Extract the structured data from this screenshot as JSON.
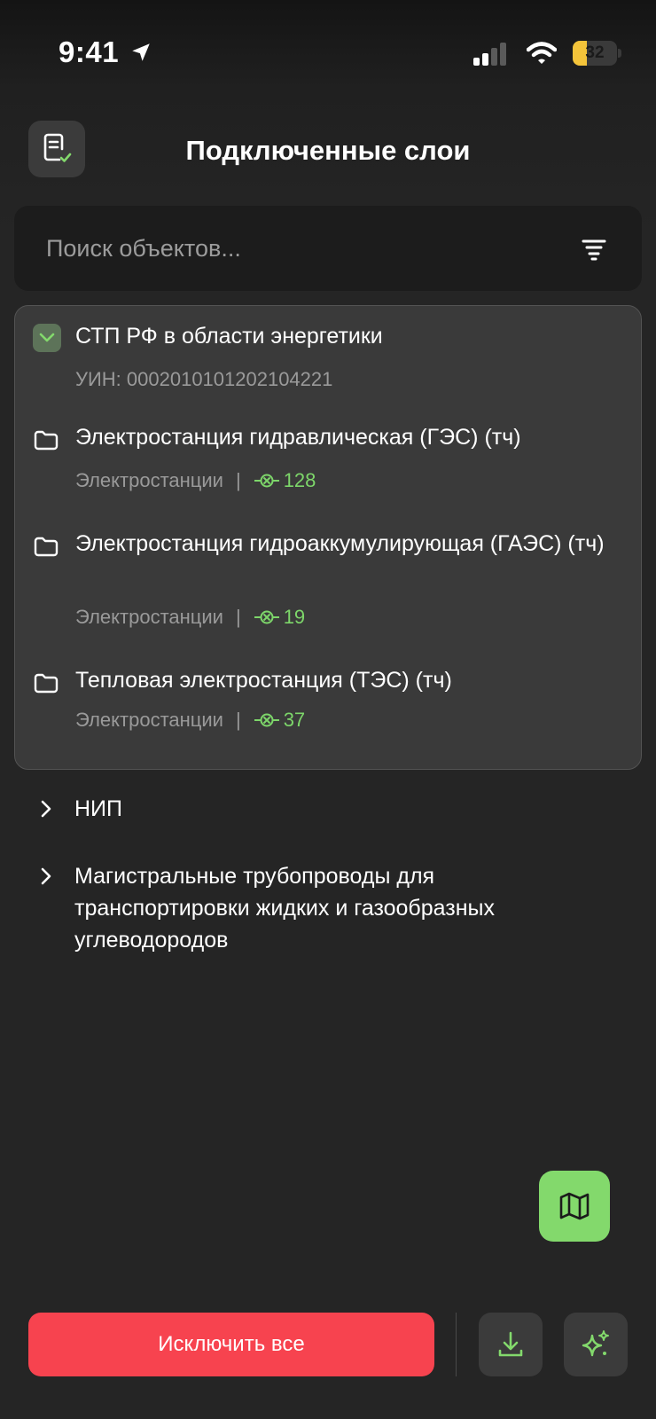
{
  "status_bar": {
    "time": "9:41",
    "battery_level": 32,
    "battery_label": "32",
    "battery_color": "#f4c43a"
  },
  "header": {
    "title": "Подключенные слои",
    "left_icon": "checklist-icon"
  },
  "search": {
    "placeholder": "Поиск объектов...",
    "value": "",
    "filter_icon": "filter-icon"
  },
  "expanded_group": {
    "title": "СТП РФ в области энергетики",
    "uin": "УИН: 0002010101202104221",
    "checked": true,
    "items": [
      {
        "title": "Электростанция гидравлическая (ГЭС) (тч)",
        "category": "Электростанции",
        "count": "128"
      },
      {
        "title": "Электростанция гидроаккумулирующая (ГАЭС) (тч)",
        "category": "Электростанции",
        "count": "19"
      },
      {
        "title": "Тепловая электростанция (ТЭС) (тч)",
        "category": "Электростанции",
        "count": "37"
      }
    ]
  },
  "collapsed_groups": [
    {
      "title": "НИП"
    },
    {
      "title": "Магистральные трубопроводы для транспортировки жидких и газообразных углеводородов"
    }
  ],
  "bottom_bar": {
    "exclude_all_label": "Исключить все",
    "download_icon": "download-icon",
    "sparkle_icon": "sparkle-icon"
  },
  "fab": {
    "icon": "map-icon"
  },
  "colors": {
    "accent_green": "#83d96c",
    "count_green": "#7dd66a",
    "danger_red": "#f7434f",
    "background": "#252525",
    "card": "#3a3a3a"
  }
}
